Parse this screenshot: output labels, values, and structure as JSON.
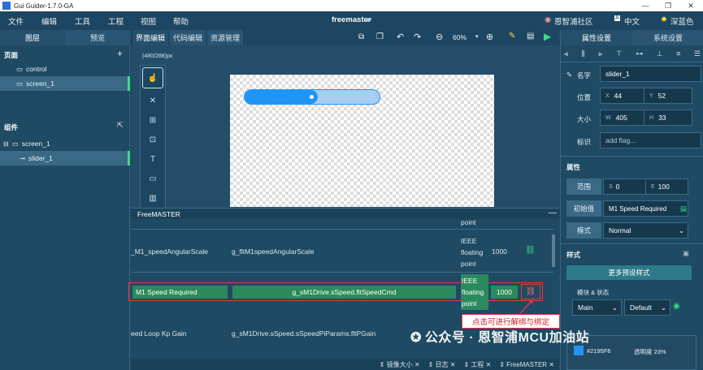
{
  "window": {
    "title": "Gui Guider-1.7.0-GA"
  },
  "menu": {
    "items": [
      "文件",
      "编辑",
      "工具",
      "工程",
      "视图",
      "帮助"
    ],
    "project": "freemaster",
    "community": "恩智浦社区",
    "language": "中文",
    "theme": "深蓝色"
  },
  "left_tabs": [
    "图层",
    "预览"
  ],
  "center_tabs": [
    "界面编辑",
    "代码编辑",
    "资源管理"
  ],
  "toolbar": {
    "zoom": "60%"
  },
  "pages": {
    "title": "页面",
    "items": [
      "control",
      "screen_1"
    ]
  },
  "components": {
    "title": "组件",
    "items": [
      "screen_1",
      "slider_1"
    ]
  },
  "canvas": {
    "size_label": "(480/288)px"
  },
  "slider": {
    "value_fraction": 0.51,
    "color": "#2195F6"
  },
  "freemaster": {
    "title": "FreeMASTER",
    "rows": [
      {
        "name": "",
        "variable": "",
        "type": "point",
        "size": ""
      },
      {
        "name": "_M1_speedAngularScale",
        "variable": "g_fltM1speedAngularScale",
        "type": "IEEE floating point",
        "size": "1000"
      },
      {
        "name": "M1 Speed Required",
        "variable": "g_sM1Drive.sSpeed.fltSpeedCmd",
        "type": "IEEE floating point",
        "size": "1000"
      },
      {
        "name": "eed Loop Kp Gain",
        "variable": "g_sM1Drive.sSpeed.sSpeedPiParams.fltPGain",
        "type": "",
        "size": ""
      }
    ],
    "callout": "点击可进行解绑与绑定"
  },
  "statusbar": {
    "items": [
      "镜像大小",
      "日志",
      "工程",
      "FreeMASTER"
    ]
  },
  "right_tabs": [
    "属性设置",
    "系统设置"
  ],
  "props": {
    "name_label": "名字",
    "name": "slider_1",
    "pos_label": "位置",
    "x": "44",
    "y": "52",
    "size_label": "大小",
    "w": "405",
    "h": "33",
    "flag_label": "标识",
    "flag_placeholder": "add flag...",
    "attr_title": "属性",
    "range_label": "范围",
    "range_s": "0",
    "range_e": "100",
    "init_label": "初始值",
    "init_value": "M1 Speed Required",
    "mode_label": "模式",
    "mode_value": "Normal",
    "style_title": "样式",
    "more_styles": "更多预设样式",
    "part_label": "模块 & 状态",
    "part": "Main",
    "state": "Default",
    "color_hex": "#2195F6",
    "opacity": "透明度 23%"
  },
  "watermark": "公众号 · 恩智浦MCU加油站"
}
